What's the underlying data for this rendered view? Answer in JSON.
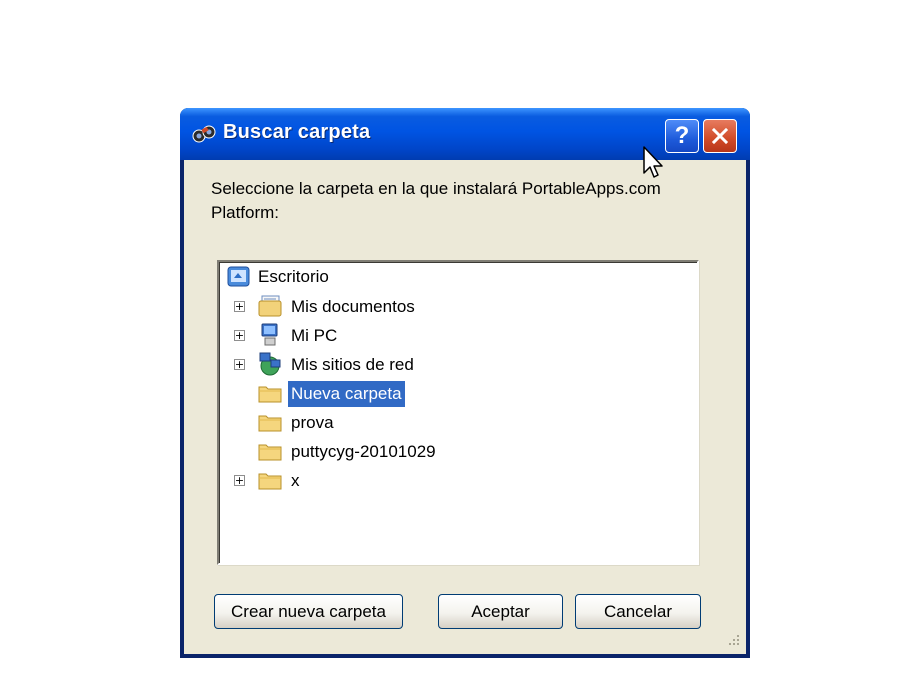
{
  "dialog": {
    "title": "Buscar carpeta",
    "help_label": "?",
    "prompt": "Seleccione la carpeta en la que instalará PortableApps.com Platform:"
  },
  "tree": {
    "root": "Escritorio",
    "items": [
      {
        "label": "Mis documentos",
        "expandable": true,
        "icon": "documents-icon",
        "selected": false
      },
      {
        "label": "Mi PC",
        "expandable": true,
        "icon": "computer-icon",
        "selected": false
      },
      {
        "label": "Mis sitios de red",
        "expandable": true,
        "icon": "network-icon",
        "selected": false
      },
      {
        "label": "Nueva carpeta",
        "expandable": false,
        "icon": "folder-icon",
        "selected": true
      },
      {
        "label": "prova",
        "expandable": false,
        "icon": "folder-icon",
        "selected": false
      },
      {
        "label": "puttycyg-20101029",
        "expandable": false,
        "icon": "folder-icon",
        "selected": false
      },
      {
        "label": "x",
        "expandable": true,
        "icon": "folder-icon",
        "selected": false
      }
    ],
    "expander_symbol": "+"
  },
  "buttons": {
    "new_folder": "Crear nueva carpeta",
    "ok": "Aceptar",
    "cancel": "Cancelar"
  },
  "colors": {
    "title_bar": "#0054e3",
    "selection": "#316ac5",
    "dialog_face": "#ece9d8",
    "close_button": "#d04a27"
  }
}
